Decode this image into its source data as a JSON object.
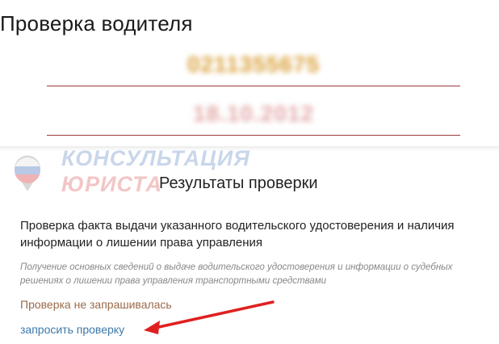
{
  "page": {
    "title": "Проверка водителя"
  },
  "form": {
    "license_number": "0211355675",
    "issue_date": "18.10.2012"
  },
  "watermark": {
    "line1": "КОНСУЛЬТАЦИЯ",
    "line2": "ЮРИСТА"
  },
  "results": {
    "title": "Результаты проверки",
    "check_title": "Проверка факта выдачи указанного водительского удостоверения и наличия информации о лишении права управления",
    "check_description": "Получение основных сведений о выдаче водительского удостоверения и информации о судебных решениях о лишении права управления транспортными средствами",
    "status": "Проверка не запрашивалась",
    "request_link": "запросить проверку"
  },
  "colors": {
    "link": "#3d78a8",
    "status": "#9a6a4a",
    "arrow": "#e02020",
    "field_underline": "#9b3a3a"
  }
}
